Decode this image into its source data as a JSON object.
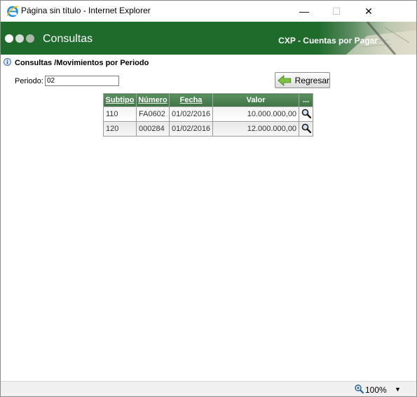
{
  "window": {
    "title": "Página sin título - Internet Explorer",
    "minimize_glyph": "—",
    "maximize_glyph": "☐",
    "close_glyph": "✕"
  },
  "banner": {
    "title": "Consultas",
    "module": "CXP - Cuentas por Pagar",
    "color": "#1e6b2c"
  },
  "page": {
    "breadcrumb": "Consultas /Movimientos por Periodo",
    "periodo_label": "Periodo:",
    "periodo_value": "02",
    "back_label": "Regresar"
  },
  "table": {
    "headers": [
      "Subtipo",
      "Número",
      "Fecha",
      "Valor",
      "..."
    ],
    "header_color": "#4a7f4f",
    "rows": [
      {
        "subtipo": "110",
        "numero": "FA0602",
        "fecha": "01/02/2016",
        "valor": "10.000.000,00",
        "action_icon": "magnifier-icon"
      },
      {
        "subtipo": "120",
        "numero": "000284",
        "fecha": "01/02/2016",
        "valor": "12.000.000,00",
        "action_icon": "magnifier-icon"
      }
    ]
  },
  "statusbar": {
    "zoom": "100%",
    "dropdown_glyph": "▼"
  }
}
